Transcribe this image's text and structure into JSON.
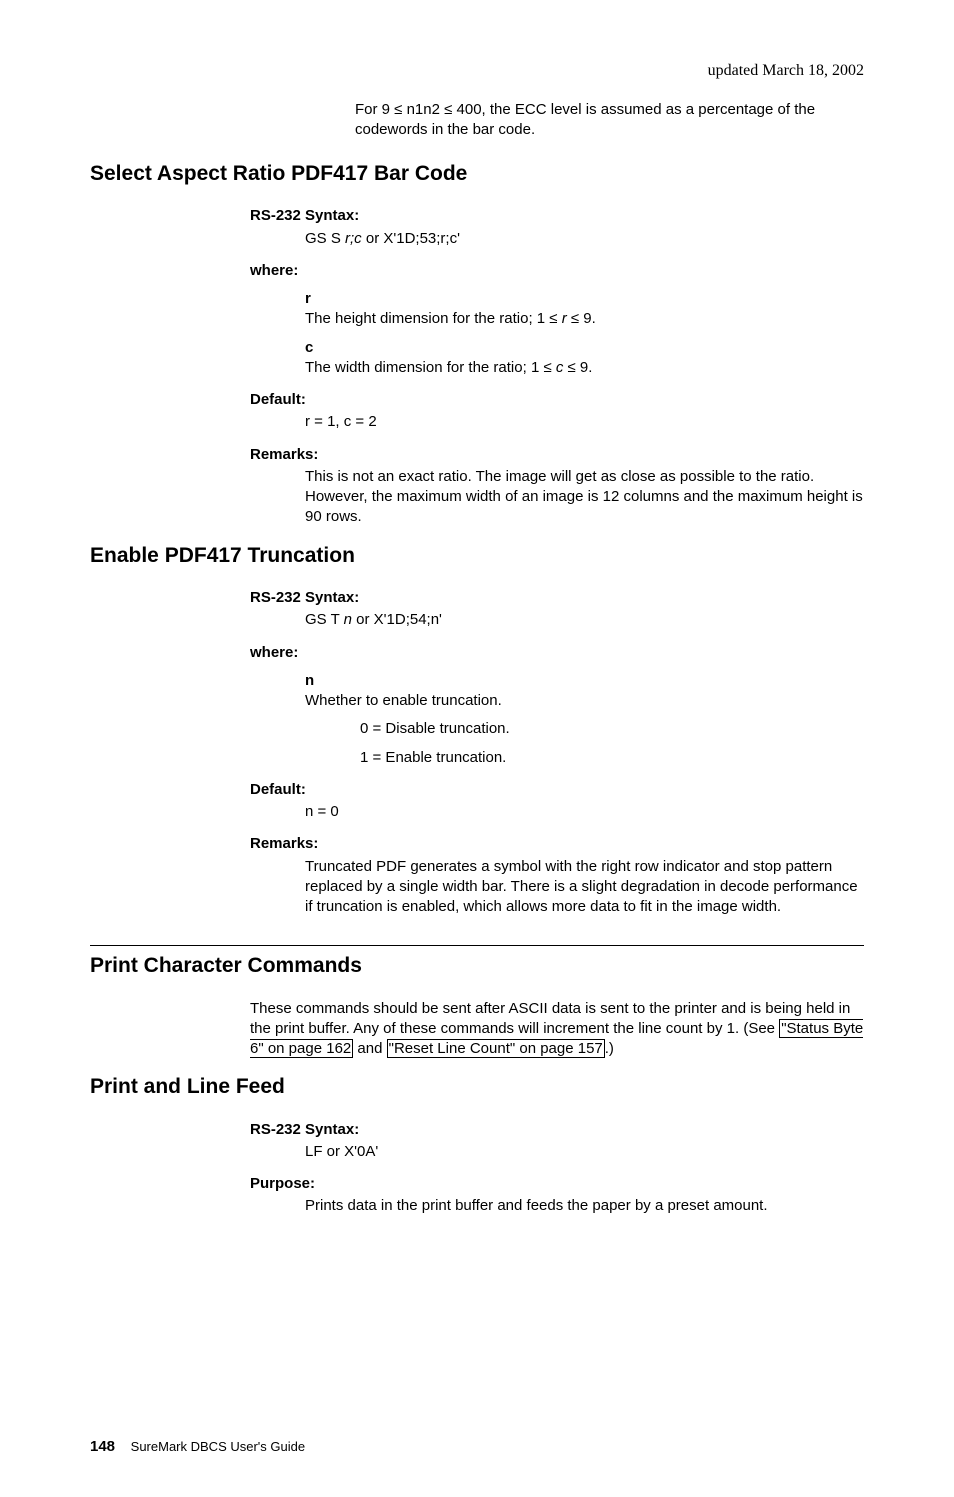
{
  "header": {
    "date": "updated March 18, 2002"
  },
  "intro": "For 9 ≤ n1n2 ≤ 400, the ECC level is assumed as a percentage of the codewords in the bar code.",
  "sec1": {
    "title": "Select Aspect Ratio PDF417 Bar Code",
    "syntax_label": "RS-232 Syntax:",
    "syntax_pre": "GS S ",
    "syntax_ital": "r;c",
    "syntax_post": " or X'1D;53;r;c'",
    "where_label": "where:",
    "r_key": "r",
    "r_desc_pre": "The height dimension for the ratio; 1 ≤ ",
    "r_desc_ital": "r",
    "r_desc_post": " ≤ 9.",
    "c_key": "c",
    "c_desc_pre": "The width dimension for the ratio; 1 ≤ ",
    "c_desc_ital": "c",
    "c_desc_post": " ≤ 9.",
    "default_label": "Default:",
    "default_body": "r = 1, c = 2",
    "remarks_label": "Remarks:",
    "remarks_body": "This is not an exact ratio. The image will get as close as possible to the ratio. However, the maximum width of an image is 12 columns and the maximum height is 90 rows."
  },
  "sec2": {
    "title": "Enable PDF417 Truncation",
    "syntax_label": "RS-232 Syntax:",
    "syntax_pre": "GS T ",
    "syntax_ital": "n",
    "syntax_post": " or X'1D;54;n'",
    "where_label": "where:",
    "n_key": "n",
    "n_desc": "Whether to enable truncation.",
    "n_opt0": "0 = Disable truncation.",
    "n_opt1": "1 = Enable truncation.",
    "default_label": "Default:",
    "default_body": "n = 0",
    "remarks_label": "Remarks:",
    "remarks_body": "Truncated PDF generates a symbol with the right row indicator and stop pattern replaced by a single width bar. There is a slight degradation in decode performance if truncation is enabled, which allows more data to fit in the image width."
  },
  "sec3": {
    "title": "Print Character Commands",
    "body_pre": "These commands should be sent after ASCII data is sent to the printer and is being held in the print buffer. Any of these commands will increment the line count by 1. (See ",
    "xref1": "\"Status Byte 6\" on page 162",
    "body_mid": " and ",
    "xref2": "\"Reset Line Count\" on page 157",
    "body_post": ".)"
  },
  "sec4": {
    "title": "Print and Line Feed",
    "syntax_label": "RS-232 Syntax:",
    "syntax_body": "LF or X'0A'",
    "purpose_label": "Purpose:",
    "purpose_body": "Prints data in the print buffer and feeds the paper by a preset amount."
  },
  "footer": {
    "page": "148",
    "book": "SureMark DBCS User's Guide"
  }
}
